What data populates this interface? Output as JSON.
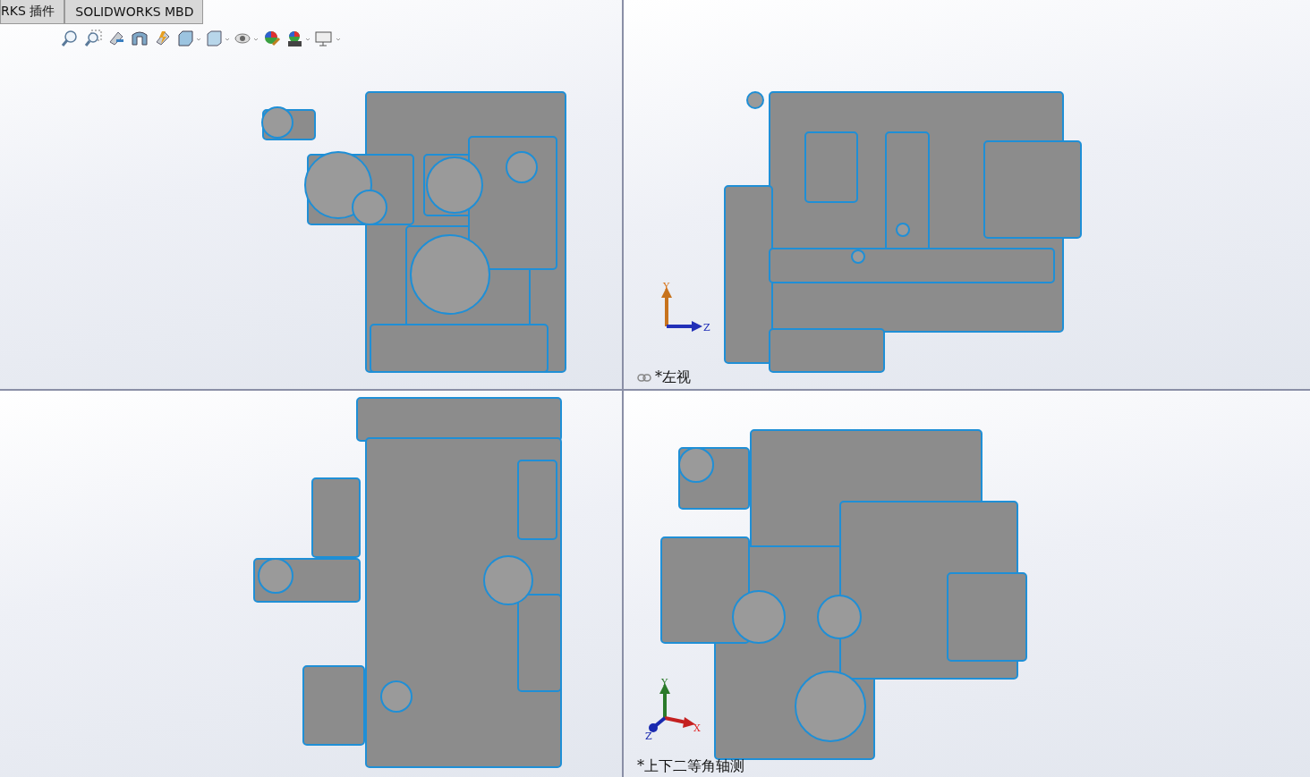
{
  "tabs": [
    {
      "label": "RKS 插件",
      "selected": false
    },
    {
      "label": "SOLIDWORKS MBD",
      "selected": false
    }
  ],
  "viewports": [
    {
      "kind": "front"
    },
    {
      "kind": "left",
      "label": "*左视",
      "linked": true,
      "triad": {
        "kind": "yz",
        "axes": [
          "Y",
          "Z"
        ]
      }
    },
    {
      "kind": "top"
    },
    {
      "kind": "iso",
      "label": "*上下二等角轴测",
      "linked": false,
      "triad": {
        "kind": "xyz",
        "axes": [
          "Y",
          "X",
          "Z"
        ]
      }
    }
  ]
}
